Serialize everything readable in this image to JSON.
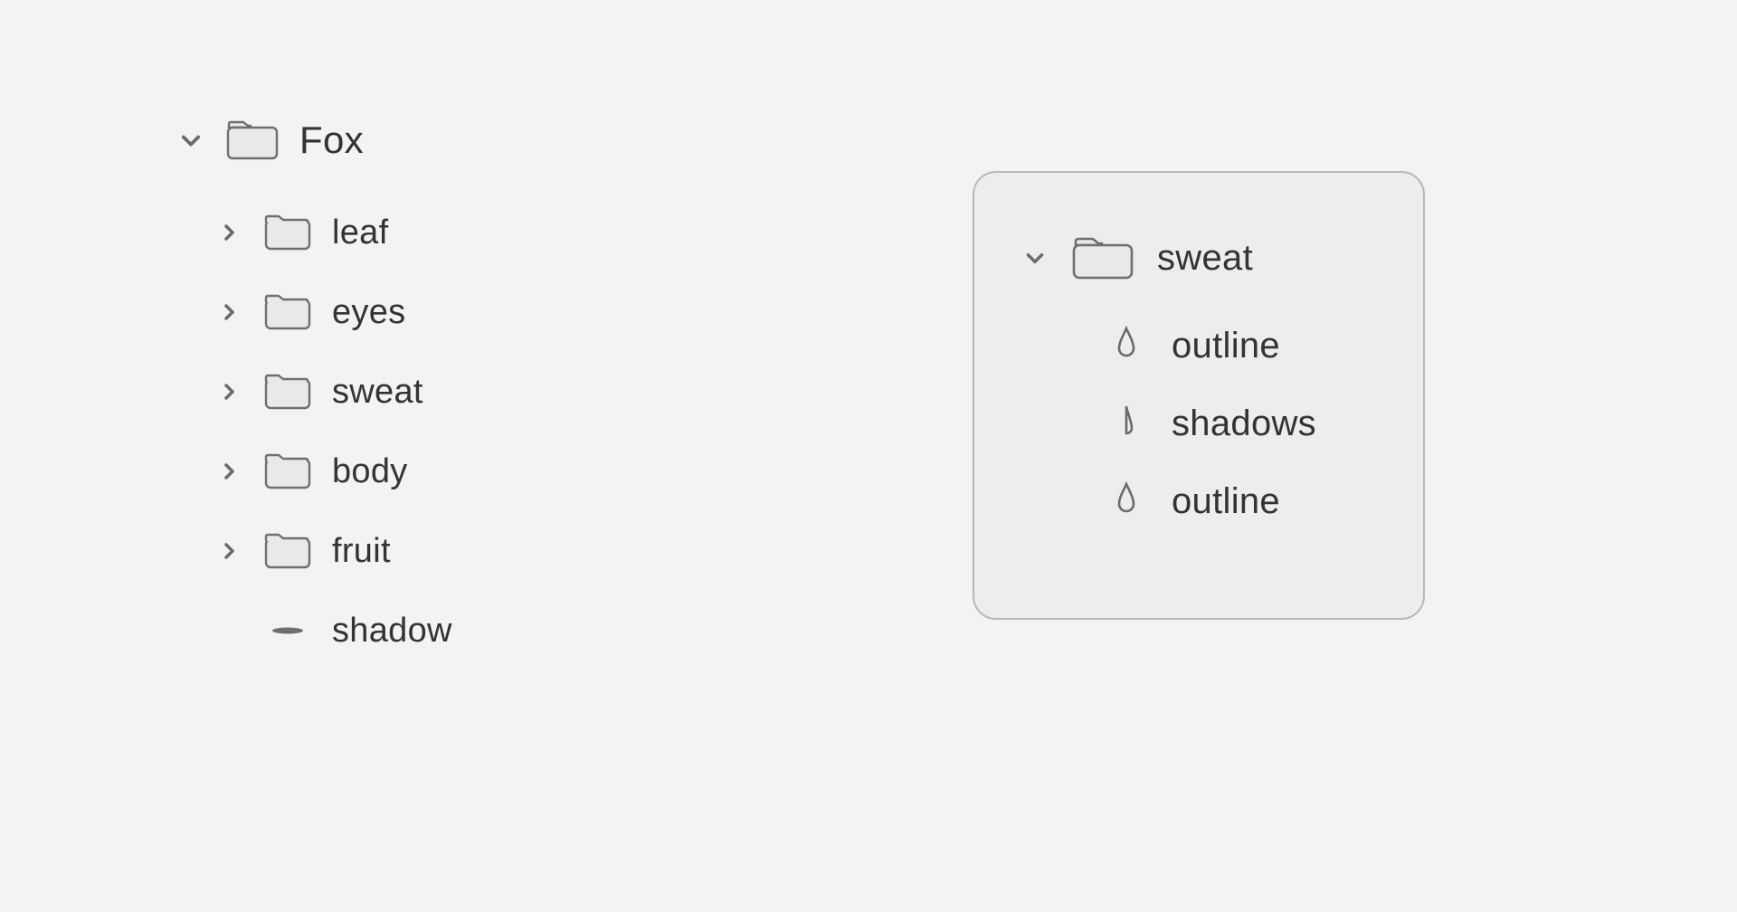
{
  "leftTree": {
    "root": {
      "label": "Fox",
      "expanded": true
    },
    "children": [
      {
        "label": "leaf",
        "type": "folder",
        "expanded": false
      },
      {
        "label": "eyes",
        "type": "folder",
        "expanded": false
      },
      {
        "label": "sweat",
        "type": "folder",
        "expanded": false
      },
      {
        "label": "body",
        "type": "folder",
        "expanded": false
      },
      {
        "label": "fruit",
        "type": "folder",
        "expanded": false
      },
      {
        "label": "shadow",
        "type": "ellipse"
      }
    ]
  },
  "rightPanel": {
    "folder": {
      "label": "sweat",
      "expanded": true
    },
    "items": [
      {
        "label": "outline",
        "icon": "drop-outline"
      },
      {
        "label": "shadows",
        "icon": "drop-half"
      },
      {
        "label": "outline",
        "icon": "drop-outline"
      }
    ]
  }
}
